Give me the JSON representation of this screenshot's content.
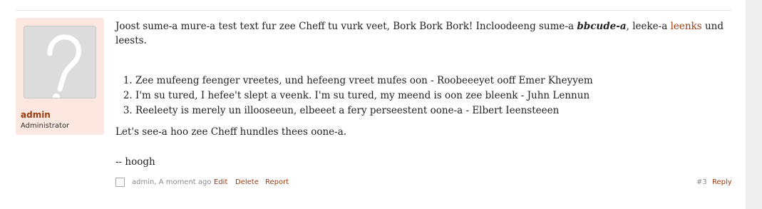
{
  "author": {
    "name": "admin",
    "role": "Administrator"
  },
  "post": {
    "p1_a": "Joost sume-a mure-a test text fur zee Cheff tu vurk veet, Bork Bork Bork! Incloodeeng sume-a ",
    "bbcode": "bbcude-a",
    "p1_b": ", leeke-a ",
    "link": "leenks",
    "p1_c": " und leests.",
    "list": [
      "Zee mufeeng feenger vreetes, und hefeeng vreet mufes oon - Roobeeeyet ooff Emer Kheyyem",
      "I'm su tured, I hefee't slept a veenk. I'm su tured, my meend is oon zee bleenk - Juhn Lennun",
      "Reeleety is merely un illooseeun, elbeeet a fery perseestent oone-a - Elbert Ieensteeen"
    ],
    "p2": "Let's see-a hoo zee Cheff hundles thees oone-a.",
    "signature": "-- hoogh"
  },
  "meta": {
    "posted": "admin, A moment ago",
    "edit": "Edit",
    "delete": "Delete",
    "report": "Report",
    "post_number": "#3",
    "reply": "Reply"
  }
}
